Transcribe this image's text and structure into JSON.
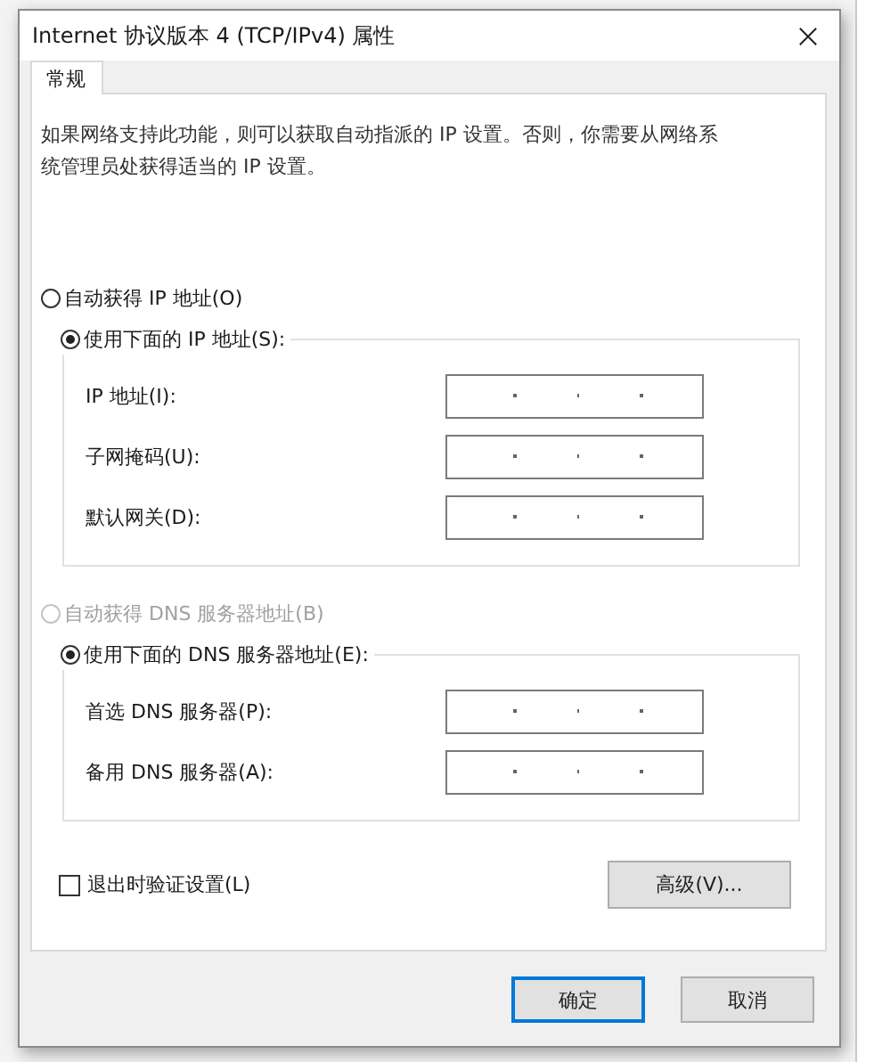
{
  "window": {
    "title": "Internet 协议版本 4 (TCP/IPv4) 属性"
  },
  "tabs": [
    {
      "label": "常规",
      "selected": true
    }
  ],
  "description": "如果网络支持此功能，则可以获取自动指派的 IP 设置。否则，你需要从网络系统管理员处获得适当的 IP 设置。",
  "ip_options": [
    {
      "label": "自动获得 IP 地址(O)",
      "selected": false,
      "disabled": false
    },
    {
      "label": "使用下面的 IP 地址(S):",
      "selected": true,
      "disabled": false
    }
  ],
  "ip_fields": [
    {
      "label": "IP 地址(I):"
    },
    {
      "label": "子网掩码(U):"
    },
    {
      "label": "默认网关(D):"
    }
  ],
  "dns_options": [
    {
      "label": "自动获得 DNS 服务器地址(B)",
      "selected": false,
      "disabled": true
    },
    {
      "label": "使用下面的 DNS 服务器地址(E):",
      "selected": true,
      "disabled": false
    }
  ],
  "dns_fields": [
    {
      "label": "首选 DNS 服务器(P):"
    },
    {
      "label": "备用 DNS 服务器(A):"
    }
  ],
  "validate_on_exit": {
    "label": "退出时验证设置(L)",
    "checked": false
  },
  "advanced_button": "高级(V)...",
  "buttons": [
    {
      "label": "确定",
      "default": true
    },
    {
      "label": "取消",
      "default": false
    }
  ]
}
